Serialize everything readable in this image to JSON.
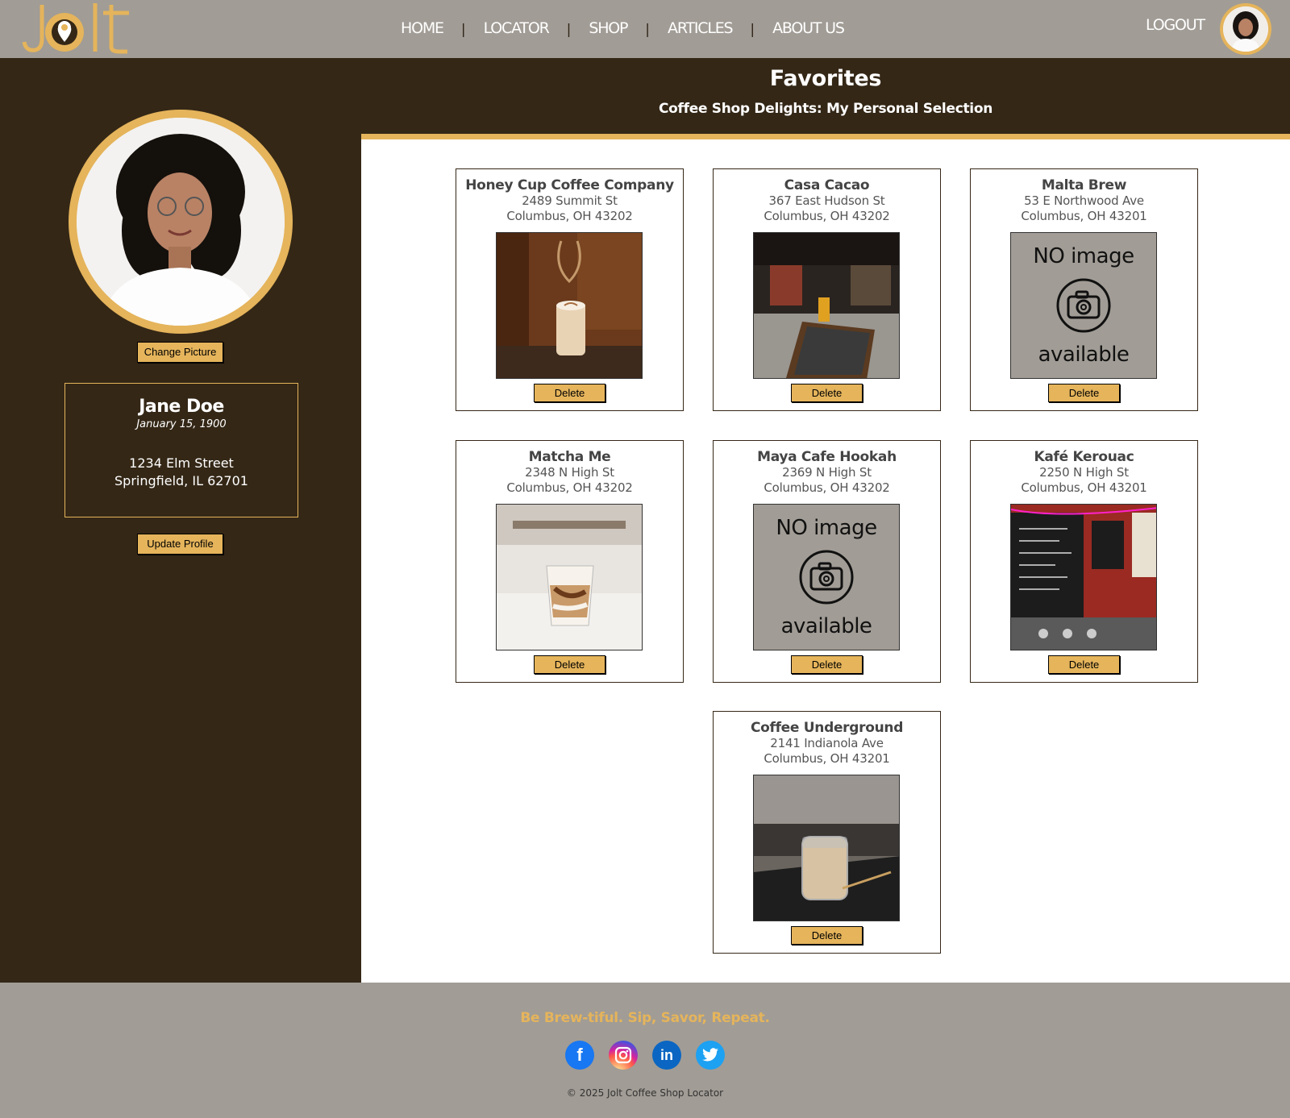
{
  "brand": {
    "logo_text": "Jolt"
  },
  "nav": {
    "items": [
      "HOME",
      "LOCATOR",
      "SHOP",
      "ARTICLES",
      "ABOUT US"
    ],
    "separator": "|",
    "logout": "LOGOUT"
  },
  "sidebar": {
    "change_picture": "Change Picture",
    "name": "Jane Doe",
    "dob": "January 15, 1900",
    "address_line1": "1234 Elm Street",
    "address_line2": "Springfield, IL 62701",
    "update_profile": "Update Profile"
  },
  "main": {
    "title": "Favorites",
    "subtitle": "Coffee Shop Delights: My Personal Selection",
    "delete_label": "Delete",
    "no_image_top": "NO image",
    "no_image_bottom": "available",
    "cards": [
      {
        "name": "Honey Cup Coffee Company",
        "street": "2489 Summit St",
        "city": "Columbus, OH  43202",
        "image": "latte-photo"
      },
      {
        "name": "Casa Cacao",
        "street": "367 East Hudson St",
        "city": "Columbus, OH  43202",
        "image": "interior-photo"
      },
      {
        "name": "Malta Brew",
        "street": "53 E Northwood Ave",
        "city": "Columbus, OH  43201",
        "image": "no-image"
      },
      {
        "name": "Matcha Me",
        "street": "2348 N High St",
        "city": "Columbus, OH  43202",
        "image": "iced-coffee-photo"
      },
      {
        "name": "Maya Cafe Hookah",
        "street": "2369 N High St",
        "city": "Columbus, OH  43202",
        "image": "no-image"
      },
      {
        "name": "Kafé Kerouac",
        "street": "2250 N High St",
        "city": "Columbus, OH  43201",
        "image": "chalkboard-photo"
      },
      {
        "name": "Coffee Underground",
        "street": "2141 Indianola Ave",
        "city": "Columbus, OH  43201",
        "image": "jar-coffee-photo"
      }
    ]
  },
  "footer": {
    "tagline": "Be Brew-tiful. Sip, Savor, Repeat.",
    "copyright": "© 2025 Jolt Coffee Shop Locator",
    "socials": [
      "facebook",
      "instagram",
      "linkedin",
      "twitter"
    ]
  },
  "colors": {
    "gold": "#e5b45b",
    "dark_brown": "#342716",
    "taupe": "#a19c95"
  }
}
